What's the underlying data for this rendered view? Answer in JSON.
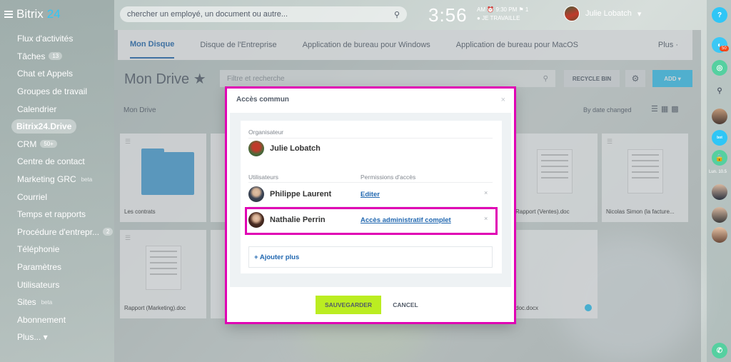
{
  "app": {
    "logo_part1": "Bitrix",
    "logo_part2": "24"
  },
  "sidebar": {
    "items": [
      {
        "label": "Flux d'activités"
      },
      {
        "label": "Tâches",
        "count": "13"
      },
      {
        "label": "Chat et Appels"
      },
      {
        "label": "Groupes de travail"
      },
      {
        "label": "Calendrier"
      },
      {
        "label": "Bitrix24.Drive",
        "active": true
      },
      {
        "label": "CRM",
        "count": "50+"
      },
      {
        "label": "Centre de contact"
      },
      {
        "label": "Marketing GRC",
        "badge": "beta"
      },
      {
        "label": "Courriel"
      },
      {
        "label": "Temps et rapports"
      },
      {
        "label": "Procédure d'entrepr...",
        "count": "2"
      },
      {
        "label": "Téléphonie"
      },
      {
        "label": "Paramètres"
      },
      {
        "label": "Utilisateurs"
      },
      {
        "label": "Sites",
        "badge": "beta"
      },
      {
        "label": "Abonnement"
      },
      {
        "label": "Plus... ▾"
      }
    ]
  },
  "header": {
    "search_placeholder": "chercher un employé, un document ou autre...",
    "clock": "3:56",
    "clock_ampm": "AM",
    "clock_status_time": "9:30 PM",
    "clock_flag": "1",
    "clock_work": "JE TRAVAILLE",
    "user_name": "Julie Lobatch"
  },
  "tabs": [
    {
      "label": "Mon Disque",
      "active": true
    },
    {
      "label": "Disque de l'Entreprise"
    },
    {
      "label": "Application de bureau pour Windows"
    },
    {
      "label": "Application de bureau pour MacOS"
    },
    {
      "label": "Plus ·"
    }
  ],
  "drive": {
    "title": "Mon Drive",
    "filter_placeholder": "Filtre et recherche",
    "recycle_label": "RECYCLE BIN",
    "add_label": "ADD ▾",
    "breadcrumb": "Mon Drive",
    "sort_label": "By date changed"
  },
  "files": [
    {
      "name": "Les contrats"
    },
    {
      "name": "Rapport (Ventes).doc"
    },
    {
      "name": "Nicolas Simon (la facture..."
    },
    {
      "name": "Rapport (Marketing).doc"
    },
    {
      "name": "doc.docx"
    }
  ],
  "right_bar": {
    "badge_count": "50",
    "date_label": "Lun. 10.5"
  },
  "modal": {
    "title": "Accès commun",
    "organizer_label": "Organisateur",
    "organizer_name": "Julie Lobatch",
    "users_label": "Utilisateurs",
    "permissions_label": "Permissions d'accès",
    "users": [
      {
        "name": "Philippe Laurent",
        "permission": "Editer"
      },
      {
        "name": "Nathalie Perrin",
        "permission": "Accès administratif complet"
      }
    ],
    "add_more": "+ Ajouter plus",
    "save_label": "SAUVEGARDER",
    "cancel_label": "CANCEL"
  },
  "colors": {
    "accent": "#2067b0",
    "highlight": "#e000b4",
    "save": "#bbed21",
    "add": "#3bc8f5"
  }
}
